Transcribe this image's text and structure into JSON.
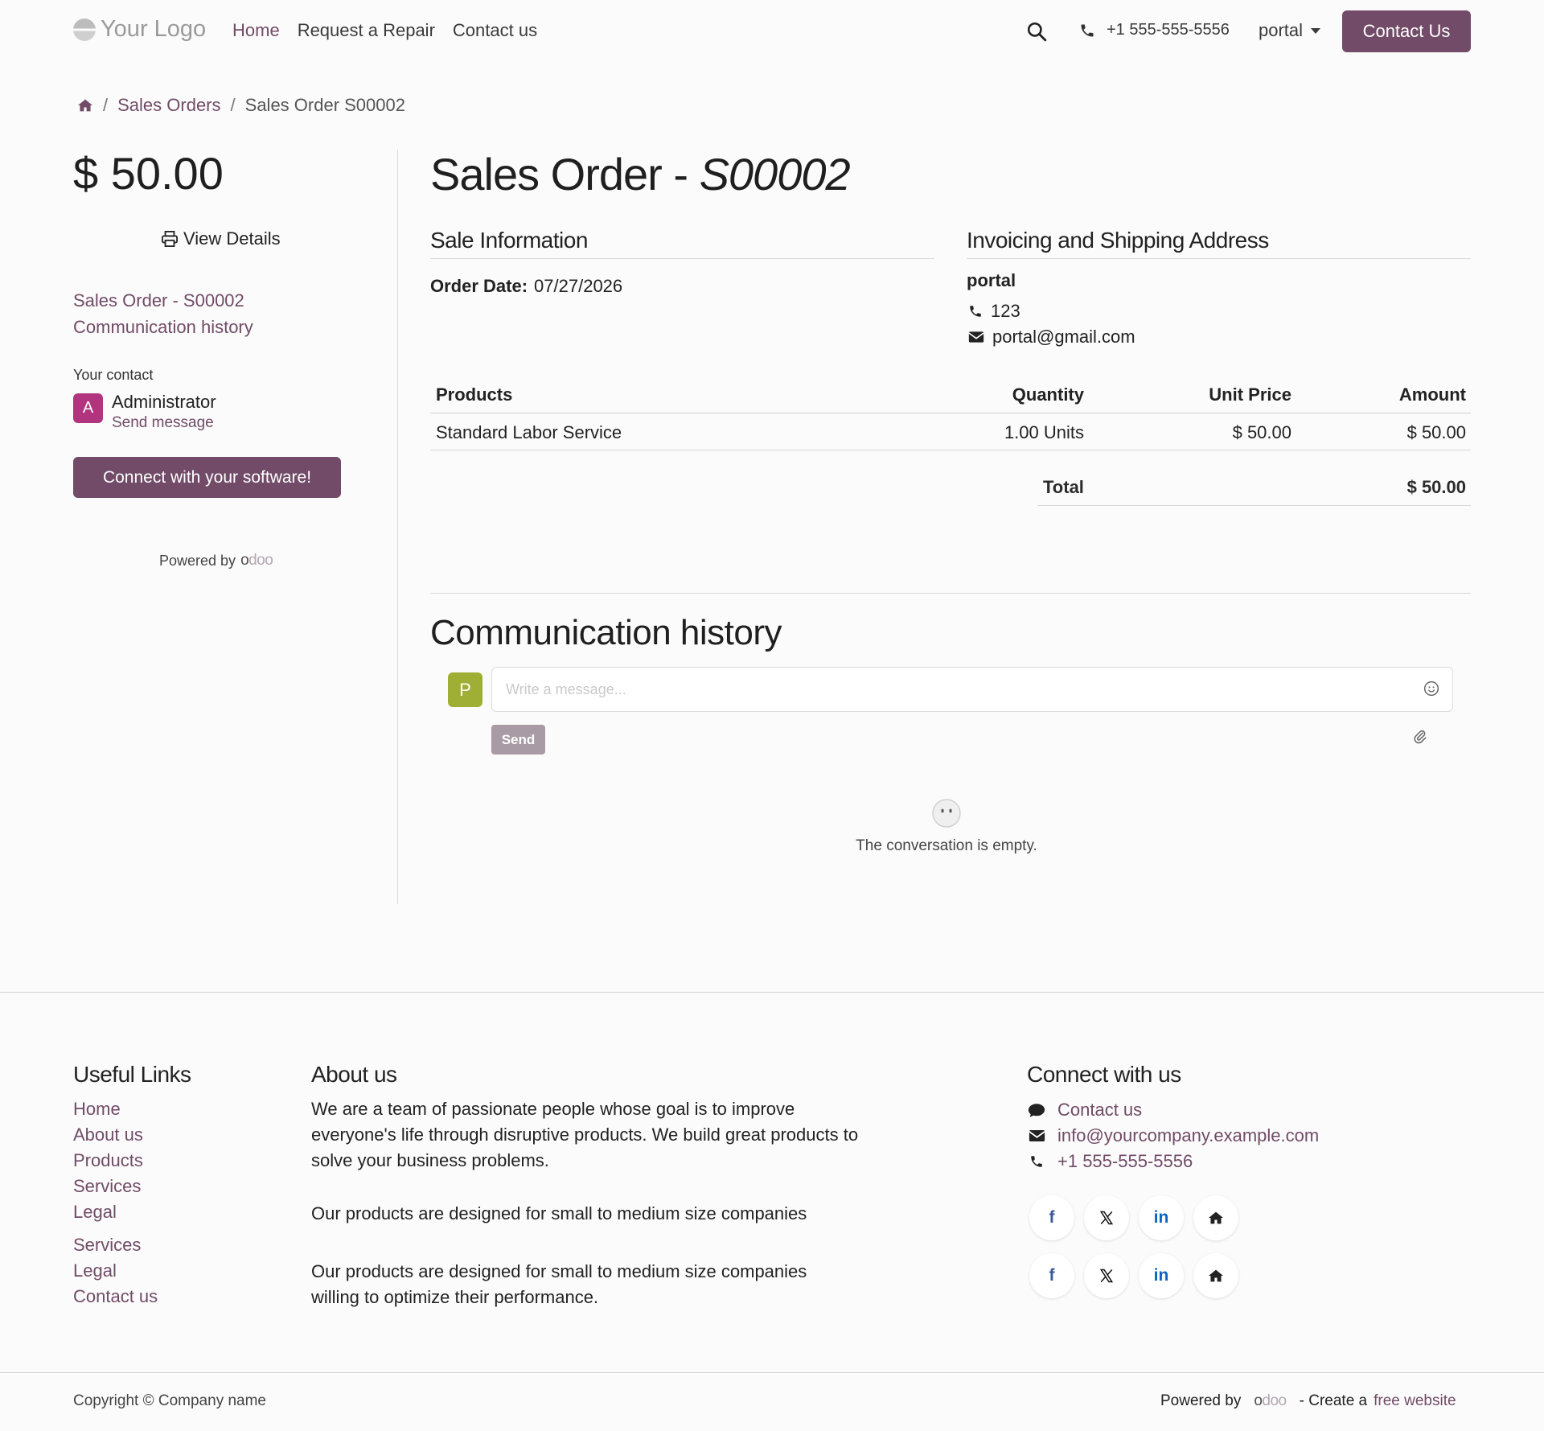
{
  "header": {
    "logo_text": "Your Logo",
    "nav": [
      {
        "label": "Home"
      },
      {
        "label": "Request a Repair"
      },
      {
        "label": "Contact us"
      }
    ],
    "phone": "+1 555-555-5556",
    "user": "portal",
    "cta": "Contact Us"
  },
  "breadcrumb": {
    "link": "Sales Orders",
    "current": "Sales Order S00002"
  },
  "sidebar": {
    "amount": "$ 50.00",
    "view_details": "View Details",
    "links": [
      "Sales Order - S00002",
      "Communication history"
    ],
    "contact_label": "Your contact",
    "contact_initial": "A",
    "contact_name": "Administrator",
    "send_message": "Send message",
    "connect_button": "Connect with your software!",
    "powered_by": "Powered by"
  },
  "main": {
    "title_prefix": "Sales Order - ",
    "title_ref": "S00002",
    "sale_info_heading": "Sale Information",
    "order_date_label": "Order Date:",
    "order_date": "07/27/2026",
    "address_heading": "Invoicing and Shipping Address",
    "address_name": "portal",
    "address_phone": "123",
    "address_email": "portal@gmail.com",
    "table": {
      "headers": [
        "Products",
        "Quantity",
        "Unit Price",
        "Amount"
      ],
      "rows": [
        {
          "product": "Standard Labor Service",
          "quantity": "1.00 Units",
          "unit_price": "$ 50.00",
          "amount": "$ 50.00"
        }
      ],
      "total_label": "Total",
      "total_value": "$ 50.00"
    },
    "communication": {
      "title": "Communication history",
      "avatar_initial": "P",
      "placeholder": "Write a message...",
      "send_label": "Send",
      "empty_text": "The conversation is empty."
    }
  },
  "footer": {
    "useful_links_heading": "Useful Links",
    "useful_links": [
      "Home",
      "About us",
      "Products",
      "Services",
      "Legal"
    ],
    "useful_links_extra": [
      "Services",
      "Legal",
      "Contact us"
    ],
    "about_heading": "About us",
    "about_p1": "We are a team of passionate people whose goal is to improve everyone's life through disruptive products. We build great products to solve your business problems.",
    "about_p2": "Our products are designed for small to medium size companies",
    "about_p3": "Our products are designed for small to medium size companies willing to optimize their performance.",
    "connect_heading": "Connect with us",
    "contact_us": "Contact us",
    "email": "info@yourcompany.example.com",
    "phone": "+1 555-555-5556",
    "copyright": "Copyright © Company name",
    "powered_by": "Powered by",
    "create_a": "- Create a",
    "free_website": "free website"
  },
  "brand": {
    "odoo_o": "o",
    "odoo_rest": "doo"
  },
  "colors": {
    "accent": "#714b67",
    "avatar_admin": "#b0357e",
    "avatar_portal": "#9fae35",
    "send_disabled": "#a99ba5"
  }
}
